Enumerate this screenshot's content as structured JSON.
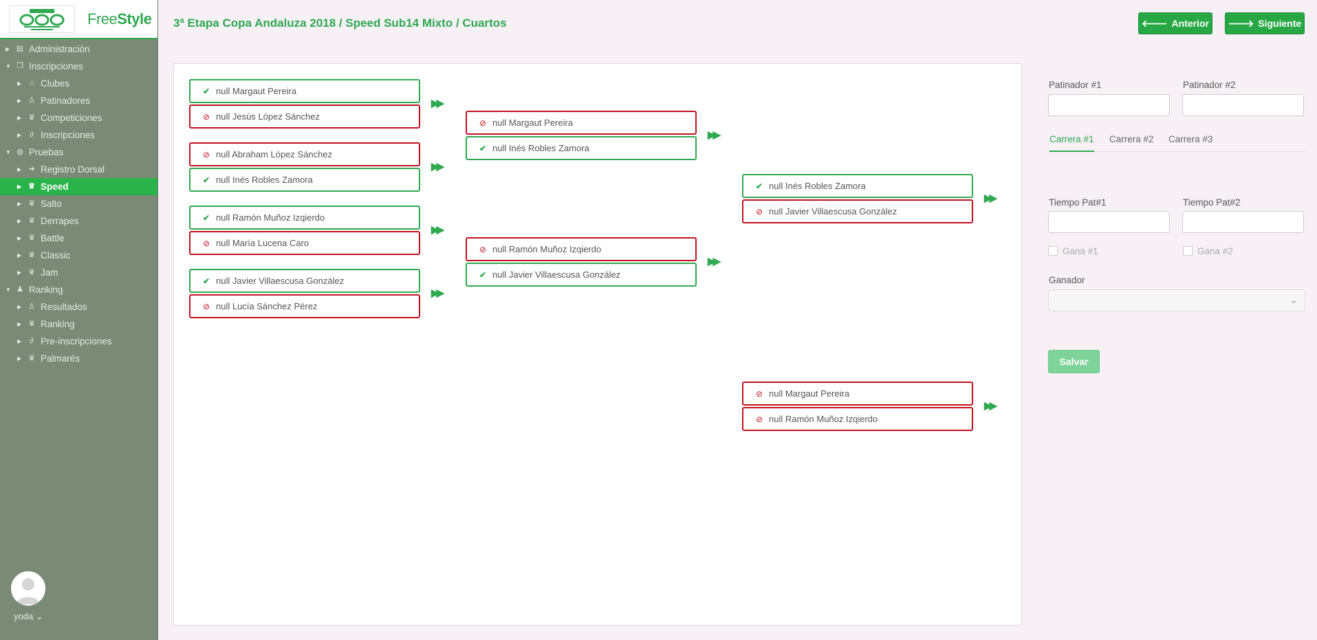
{
  "brand": {
    "free": "Free",
    "style": "Style"
  },
  "sidebar": {
    "items": [
      {
        "label": "Administración",
        "icon": "archive-icon",
        "level": 0
      },
      {
        "label": "Inscripciones",
        "icon": "copy-icon",
        "level": 0
      },
      {
        "label": "Clubes",
        "icon": "bank-icon",
        "level": 1
      },
      {
        "label": "Patinadores",
        "icon": "male-icon",
        "level": 1
      },
      {
        "label": "Competiciones",
        "icon": "trophy-icon",
        "level": 1
      },
      {
        "label": "Inscripciones",
        "icon": "paperclip-icon",
        "level": 1
      },
      {
        "label": "Pruebas",
        "icon": "gamepad-icon",
        "level": 0
      },
      {
        "label": "Registro Dorsal",
        "icon": "sign-in-icon",
        "level": 1
      },
      {
        "label": "Speed",
        "icon": "trophy-icon",
        "level": 1,
        "active": true
      },
      {
        "label": "Salto",
        "icon": "trophy-icon",
        "level": 1
      },
      {
        "label": "Derrapes",
        "icon": "trophy-icon",
        "level": 1
      },
      {
        "label": "Battle",
        "icon": "trophy-icon",
        "level": 1
      },
      {
        "label": "Classic",
        "icon": "trophy-icon",
        "level": 1
      },
      {
        "label": "Jam",
        "icon": "trophy-icon",
        "level": 1
      },
      {
        "label": "Ranking",
        "icon": "users-icon",
        "level": 0
      },
      {
        "label": "Resultados",
        "icon": "male-icon",
        "level": 1
      },
      {
        "label": "Ranking",
        "icon": "trophy-icon",
        "level": 1
      },
      {
        "label": "Pre-inscripciones",
        "icon": "paperclip-icon",
        "level": 1
      },
      {
        "label": "Palmarés",
        "icon": "trophy-icon",
        "level": 1
      }
    ]
  },
  "user": {
    "name": "yoda ⌄"
  },
  "header": {
    "title": "3ª Etapa Copa Andaluza 2018 / Speed Sub14 Mixto / Cuartos",
    "prev_label": "Anterior",
    "next_label": "Siguiente"
  },
  "bracket": {
    "matches": [
      {
        "entries": [
          {
            "name": "null Margaut Pereira",
            "result": "win"
          },
          {
            "name": "null Jesús López Sánchez",
            "result": "lose"
          }
        ]
      },
      {
        "entries": [
          {
            "name": "null Abraham López Sánchez",
            "result": "lose"
          },
          {
            "name": "null Inés Robles Zamora",
            "result": "win"
          }
        ]
      },
      {
        "entries": [
          {
            "name": "null Ramón Muñoz Izqierdo",
            "result": "win"
          },
          {
            "name": "null María Lucena Caro",
            "result": "lose"
          }
        ]
      },
      {
        "entries": [
          {
            "name": "null Javier Villaescusa González",
            "result": "win"
          },
          {
            "name": "null Lucía Sánchez Pérez",
            "result": "lose"
          }
        ]
      },
      {
        "entries": [
          {
            "name": "null Margaut Pereira",
            "result": "lose"
          },
          {
            "name": "null Inés Robles Zamora",
            "result": "win"
          }
        ]
      },
      {
        "entries": [
          {
            "name": "null Ramón Muñoz Izqierdo",
            "result": "lose"
          },
          {
            "name": "null Javier Villaescusa González",
            "result": "win"
          }
        ]
      },
      {
        "entries": [
          {
            "name": "null Inés Robles Zamora",
            "result": "win"
          },
          {
            "name": "null Javier Villaescusa González",
            "result": "lose"
          }
        ]
      },
      {
        "entries": [
          {
            "name": "null Margaut Pereira",
            "result": "lose"
          },
          {
            "name": "null Ramón Muñoz Izqierdo",
            "result": "lose"
          }
        ]
      }
    ]
  },
  "form": {
    "pat1_label": "Patinador #1",
    "pat2_label": "Patinador #2",
    "pat1_value": "",
    "pat2_value": "",
    "tabs": [
      "Carrera #1",
      "Carrera #2",
      "Carrera #3"
    ],
    "tiempo1_label": "Tiempo Pat#1",
    "tiempo2_label": "Tiempo Pat#2",
    "tiempo1_value": "",
    "tiempo2_value": "",
    "gana1_label": "Gana #1",
    "gana2_label": "Gana #2",
    "ganador_label": "Ganador",
    "save_label": "Salvar"
  },
  "colors": {
    "accent": "#2fa84f",
    "win": "#2fa84f",
    "lose": "#c0111f",
    "sidebar_bg": "#7a8a77",
    "active_item": "#2ab34a"
  }
}
